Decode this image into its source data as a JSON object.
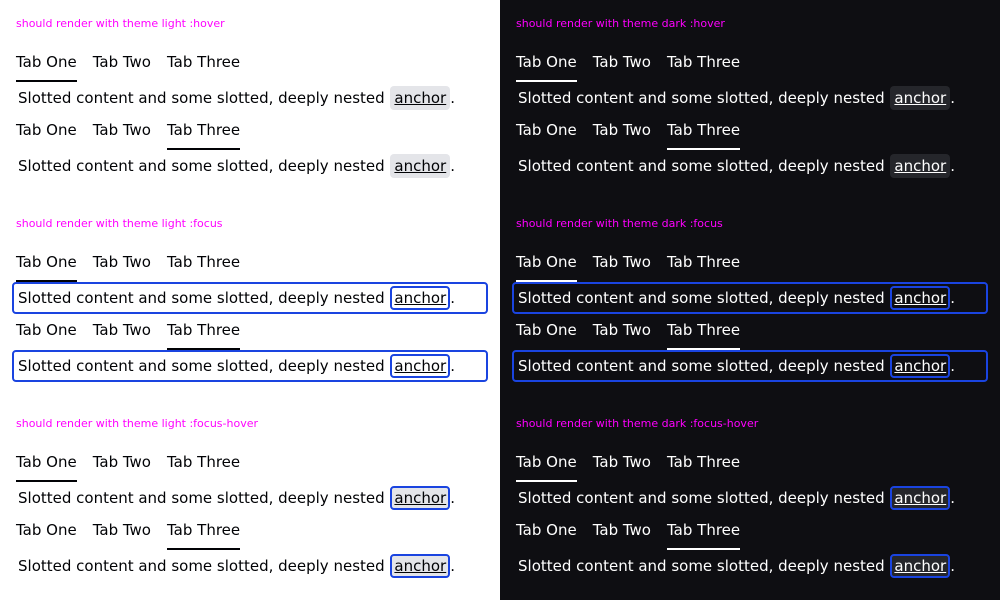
{
  "themes": [
    {
      "id": "light",
      "sections": [
        {
          "caption": "should render with theme light :hover",
          "state": "hover"
        },
        {
          "caption": "should render with theme light :focus",
          "state": "focus"
        },
        {
          "caption": "should render with theme light :focus-hover",
          "state": "focus-hover"
        }
      ]
    },
    {
      "id": "dark",
      "sections": [
        {
          "caption": "should render with theme dark :hover",
          "state": "hover"
        },
        {
          "caption": "should render with theme dark :focus",
          "state": "focus"
        },
        {
          "caption": "should render with theme dark :focus-hover",
          "state": "focus-hover"
        }
      ]
    }
  ],
  "tabs": [
    "Tab One",
    "Tab Two",
    "Tab Three"
  ],
  "groups": [
    {
      "active_tab": "Tab One"
    },
    {
      "active_tab": "Tab Three"
    }
  ],
  "content": {
    "text": "Slotted content and some slotted, deeply nested ",
    "anchor": "anchor",
    "suffix": "."
  },
  "colors": {
    "caption": "#ff007f",
    "focus_ring": "#1a44e0",
    "light_bg": "#ffffff",
    "dark_bg": "#0e0e12"
  }
}
